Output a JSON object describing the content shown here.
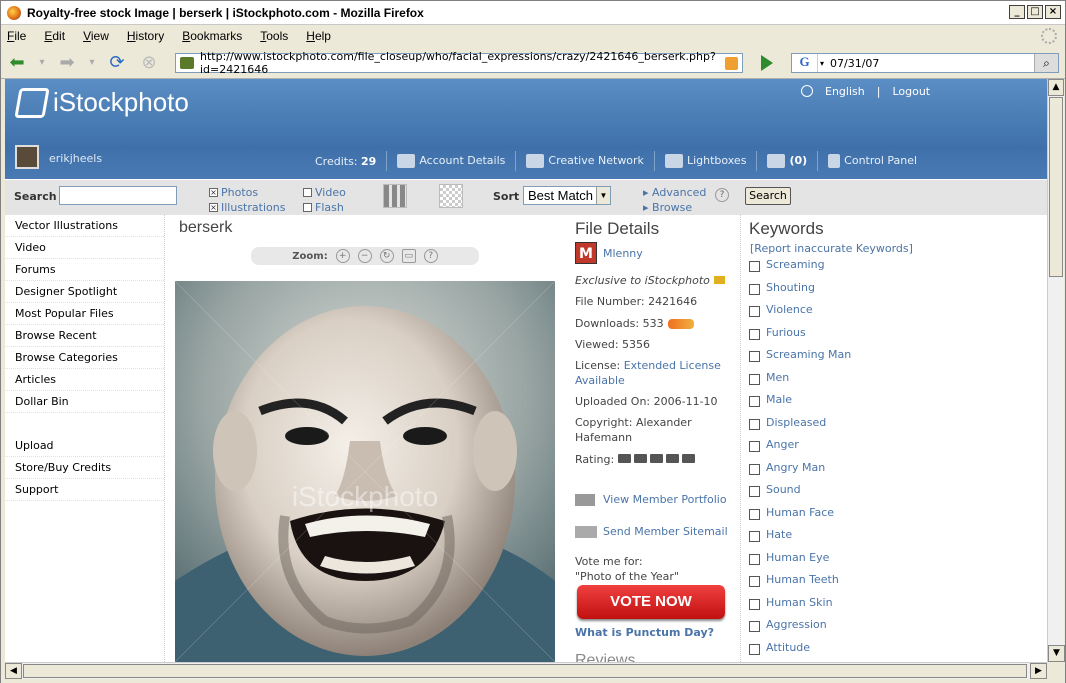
{
  "window": {
    "title": "Royalty-free stock Image | berserk | iStockphoto.com - Mozilla Firefox"
  },
  "menu": [
    "File",
    "Edit",
    "View",
    "History",
    "Bookmarks",
    "Tools",
    "Help"
  ],
  "address": {
    "url": "http://www.istockphoto.com/file_closeup/who/facial_expressions/crazy/2421646_berserk.php?id=2421646"
  },
  "search_box": {
    "engine": "G",
    "value": "07/31/07"
  },
  "site": {
    "logo": "iStockphoto",
    "lang": "English",
    "sep": "|",
    "logout": "Logout",
    "username": "erikjheels",
    "credits_label": "Credits:",
    "credits_value": "29",
    "account": "Account Details",
    "network": "Creative Network",
    "lightboxes": "Lightboxes",
    "messages": "(0)",
    "control_panel": "Control Panel"
  },
  "searchbar": {
    "label": "Search",
    "photos": "Photos",
    "illustrations": "Illustrations",
    "video": "Video",
    "flash": "Flash",
    "sort_label": "Sort",
    "sort_value": "Best Match",
    "advanced": "Advanced",
    "browse": "Browse",
    "qmark": "?",
    "button": "Search"
  },
  "leftnav": [
    "Vector Illustrations",
    "Video",
    "Forums",
    "Designer Spotlight",
    "Most Popular Files",
    "Browse Recent",
    "Browse Categories",
    "Articles",
    "Dollar Bin"
  ],
  "leftnav2": [
    "Upload",
    "Store/Buy Credits",
    "Support"
  ],
  "main": {
    "title": "berserk",
    "zoom": "Zoom:",
    "watermark": "iStockphoto"
  },
  "details": {
    "heading": "File Details",
    "m": "M",
    "author": "Mlenny",
    "exclusive": "Exclusive to iStockphoto",
    "file_number": "File Number: 2421646",
    "downloads": "Downloads: 533",
    "viewed": "Viewed: 5356",
    "license_label": "License:",
    "license_value": "Extended License",
    "license_value2": "Available",
    "uploaded": "Uploaded On: 2006-11-10",
    "copyright1": "Copyright: Alexander",
    "copyright2": "Hafemann",
    "rating": "Rating:",
    "portfolio": "View Member Portfolio",
    "sitemail": "Send Member Sitemail",
    "vote1": "Vote me for:",
    "vote2": "\"Photo of the Year\"",
    "vote_btn": "VOTE NOW",
    "punctum": "What is Punctum Day?",
    "reviews": "Reviews"
  },
  "keywords": {
    "heading": "Keywords",
    "report": "[Report inaccurate Keywords]",
    "items": [
      "Screaming",
      "Shouting",
      "Violence",
      "Furious",
      "Screaming Man",
      "Men",
      "Male",
      "Displeased",
      "Anger",
      "Angry Man",
      "Sound",
      "Human Face",
      "Hate",
      "Human Eye",
      "Human Teeth",
      "Human Skin",
      "Aggression",
      "Attitude"
    ]
  },
  "colors": {
    "header": "#4a7bb5",
    "link": "#4a74a8",
    "vote": "#d82020"
  }
}
